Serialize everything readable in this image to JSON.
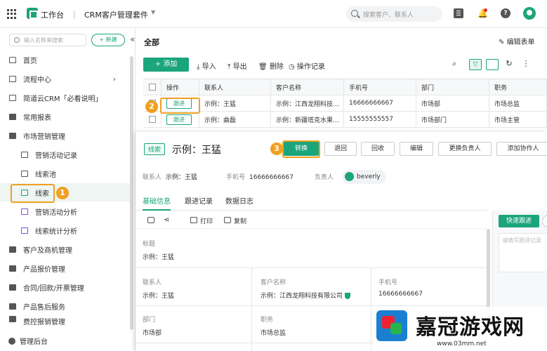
{
  "topbar": {
    "app_name": "工作台",
    "separator": "|",
    "suite_name": "CRM客户管理套件",
    "search_placeholder": "搜索客户、联系人"
  },
  "sidebar": {
    "search_placeholder": "输入名称来搜索",
    "new_label": "+ 新建",
    "collapse": "«",
    "items": [
      {
        "label": "首页"
      },
      {
        "label": "流程中心"
      },
      {
        "label": "简道云CRM「必看说明」"
      },
      {
        "label": "常用报表"
      },
      {
        "label": "市场营销管理"
      },
      {
        "label": "营销活动记录"
      },
      {
        "label": "线索池"
      },
      {
        "label": "线索"
      },
      {
        "label": "营销活动分析"
      },
      {
        "label": "线索统计分析"
      },
      {
        "label": "客户及商机管理"
      },
      {
        "label": "产品报价管理"
      },
      {
        "label": "合同/回款/开票管理"
      },
      {
        "label": "产品售后服务"
      },
      {
        "label": "费控报销管理"
      }
    ],
    "footer": "管理后台"
  },
  "main": {
    "title": "全部",
    "edit_form": "编辑表单",
    "toolbar": {
      "add": "+ 添加",
      "import": "导入",
      "export": "导出",
      "delete": "删除",
      "log": "操作记录"
    },
    "table": {
      "headers": [
        "操作",
        "联系人",
        "客户名称",
        "手机号",
        "部门",
        "职务"
      ],
      "rows": [
        {
          "action": "跟进",
          "contact": "示例：王猛",
          "company": "示例：江西龙翔科技…",
          "phone": "16666666667",
          "dept": "市场部",
          "title": "市场总监"
        },
        {
          "action": "跟进",
          "contact": "示例：曲磊",
          "company": "示例：新疆塔克水果…",
          "phone": "15555555557",
          "dept": "市场部门",
          "title": "市场主管"
        }
      ]
    }
  },
  "panel": {
    "tag": "线索",
    "title": "示例：王猛",
    "buttons": [
      "转换",
      "退回",
      "回收",
      "编辑",
      "更换负责人",
      "添加协作人"
    ],
    "meta": {
      "contact_label": "联系人",
      "contact_value": "示例：王猛",
      "phone_label": "手机号",
      "phone_value": "16666666667",
      "owner_label": "负责人",
      "owner_value": "beverly"
    },
    "tabs": [
      "基础信息",
      "跟进记录",
      "数据日志"
    ],
    "tools": {
      "print": "打印",
      "copy": "复制"
    },
    "fields": {
      "title_label": "标题",
      "title_value": "示例：王猛",
      "contact_label": "联系人",
      "contact_value": "示例：王猛",
      "company_label": "客户名称",
      "company_value": "示例：江西龙翔科技有限公司",
      "phone_label": "手机号",
      "phone_value": "16666666667",
      "dept_label": "部门",
      "dept_value": "市场部",
      "job_label": "职务",
      "job_value": "市场总监"
    },
    "quick_follow": "快速跟进",
    "note_placeholder": "请填写跟进记录"
  },
  "badges": [
    "1",
    "2",
    "3"
  ],
  "watermark": {
    "text": "嘉冠游戏网",
    "url": "www.03mm.net"
  },
  "colors": {
    "accent": "#1aa57b",
    "highlight": "#f0a020"
  }
}
